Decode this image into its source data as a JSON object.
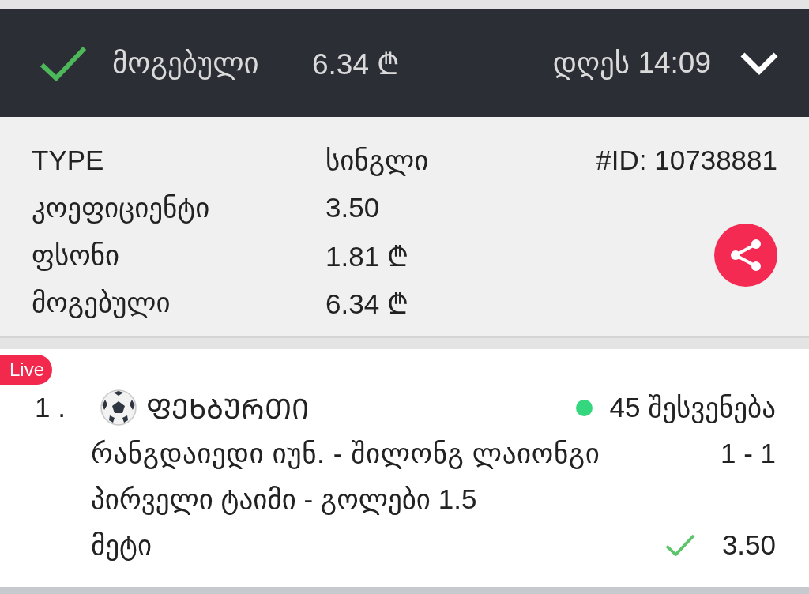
{
  "header": {
    "won": true,
    "status_label": "მოგებული",
    "amount": "6.34 ₾",
    "date": "დღეს 14:09"
  },
  "details": {
    "rows": [
      {
        "label": "TYPE",
        "value": "სინგლი"
      },
      {
        "label": "კოეფიციენტი",
        "value": "3.50"
      },
      {
        "label": "ფსონი",
        "value": "1.81 ₾"
      },
      {
        "label": "მოგებული",
        "value": "6.34 ₾"
      }
    ],
    "bet_id": "#ID: 10738881"
  },
  "events": [
    {
      "badge": "Live",
      "number": "1 .",
      "sport": "ᲤᲔᲮᲑᲣᲠᲗᲘ",
      "color": "#34d67e",
      "status": "45 შესვენება",
      "match": "რანგდაიედი იუნ. - შილონგ ლაიონგი",
      "score": "1 - 1",
      "market": "პირველი ტაიმი - გოლები 1.5",
      "selection": "მეტი",
      "won": true,
      "odds": "3.50"
    }
  ]
}
